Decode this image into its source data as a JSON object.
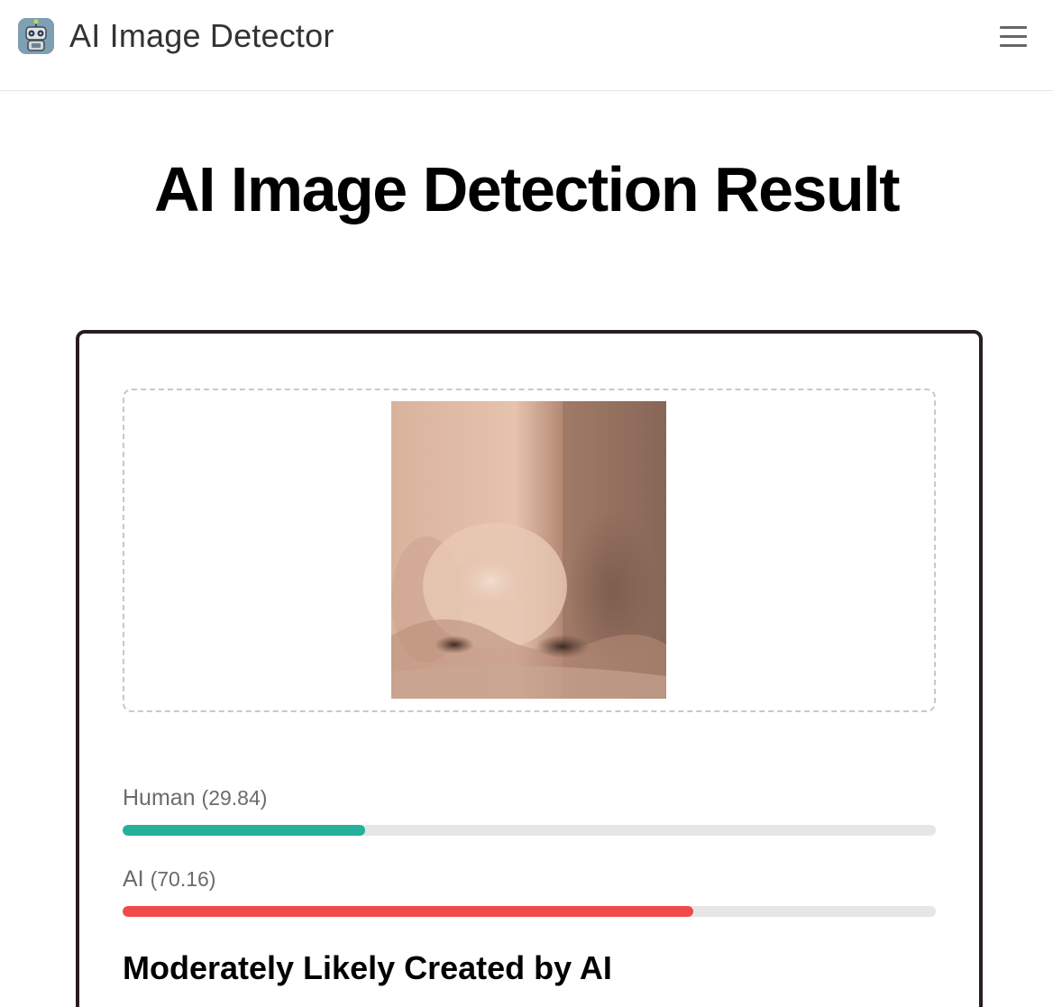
{
  "app": {
    "brand": "AI Image Detector",
    "logo_icon": "robot-icon",
    "menu_icon": "hamburger-menu-icon"
  },
  "page": {
    "title": "AI Image Detection Result"
  },
  "result": {
    "image_icon": "uploaded-photo-nose",
    "metrics": [
      {
        "name": "Human",
        "value_text": "(29.84)",
        "value": 29.84,
        "color": "#25b09b"
      },
      {
        "name": "AI",
        "value_text": "(70.16)",
        "value": 70.16,
        "color": "#f04a4a"
      }
    ],
    "verdict": "Moderately Likely Created by AI"
  },
  "colors": {
    "card_border": "#2a1d1d",
    "track": "#e6e6e6",
    "label": "#6b6b6b"
  }
}
